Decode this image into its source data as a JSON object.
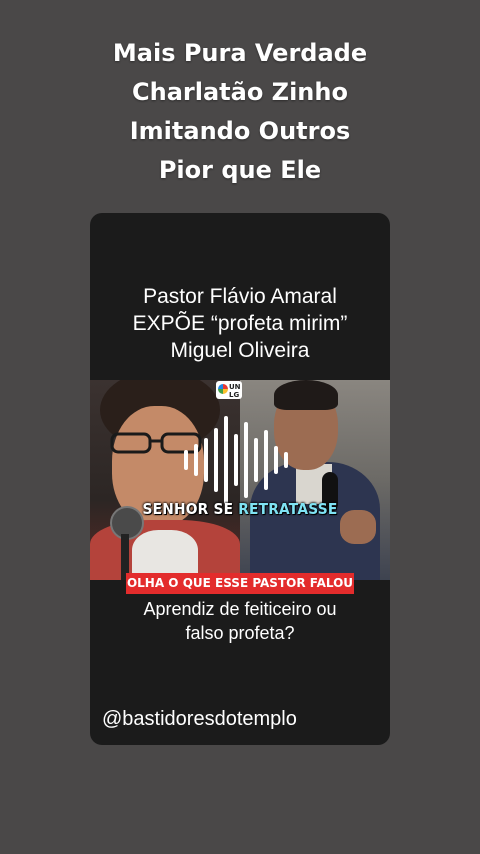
{
  "top_caption": {
    "line1": "Mais Pura Verdade",
    "line2": "Charlatão Zinho",
    "line3": "Imitando Outros",
    "line4": "Pior que Ele"
  },
  "card": {
    "title_line1": "Pastor Flávio Amaral",
    "title_line2": "EXPÕE “profeta mirim”",
    "title_line3": "Miguel Oliveira",
    "thumbnail": {
      "logo_text": "UN LG",
      "subtitle_part1": "SENHOR SE ",
      "subtitle_part2": "RETRATASSE",
      "banner": "OLHA O QUE ESSE PASTOR FALOU"
    },
    "question_line1": "Aprendiz de feiticeiro ou",
    "question_line2": "falso profeta?",
    "handle": "@bastidoresdotemplo"
  },
  "colors": {
    "background": "#4a4848",
    "card": "#1b1b1b",
    "banner_red": "#e32c2c",
    "subtitle_cyan": "#7fe3f4"
  },
  "icons": [
    "audio-waveform-icon",
    "channel-logo-icon"
  ]
}
